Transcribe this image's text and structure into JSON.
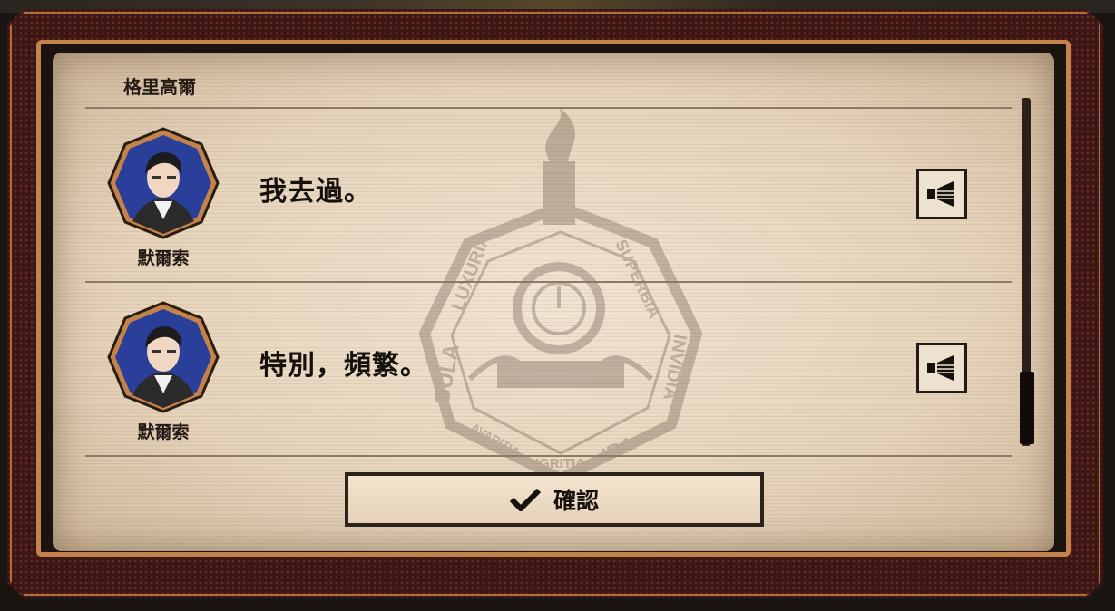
{
  "dialog": {
    "header_speaker": "格里高爾",
    "entries": [
      {
        "speaker": "默爾索",
        "text": "我去過。",
        "icon": "speaker-icon"
      },
      {
        "speaker": "默爾索",
        "text": "特別，頻繁。",
        "icon": "speaker-icon"
      }
    ],
    "confirm_label": "確認",
    "confirm_icon": "checkmark-icon"
  },
  "emblem": {
    "texts": [
      "LUXURIA",
      "GULA",
      "SUPERBIA",
      "INVIDIA",
      "AVARITIA",
      "PIGRITIA",
      "IRA"
    ]
  },
  "colors": {
    "copper": "#c3834a",
    "paper": "#ebdcc7",
    "ink": "#17110d",
    "portrait_bg": "#2a3f9a"
  }
}
